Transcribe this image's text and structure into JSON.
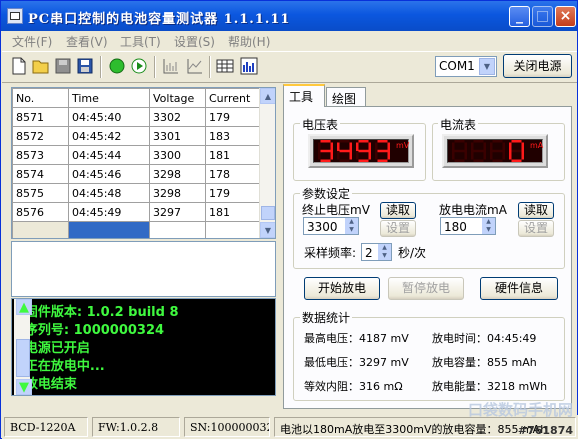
{
  "window": {
    "title": "PC串口控制的电池容量测试器 1.1.1.11"
  },
  "menu": [
    "文件(F)",
    "查看(V)",
    "工具(T)",
    "设置(S)",
    "帮助(H)"
  ],
  "toolbar": {
    "port": "COM1",
    "close_power_label": "关闭电源"
  },
  "table": {
    "columns": [
      "No.",
      "Time",
      "Voltage",
      "Current"
    ],
    "rows": [
      [
        "8571",
        "04:45:40",
        "3302",
        "179"
      ],
      [
        "8572",
        "04:45:42",
        "3301",
        "183"
      ],
      [
        "8573",
        "04:45:44",
        "3300",
        "181"
      ],
      [
        "8574",
        "04:45:46",
        "3298",
        "178"
      ],
      [
        "8575",
        "04:45:48",
        "3298",
        "179"
      ],
      [
        "8576",
        "04:45:49",
        "3297",
        "181"
      ]
    ]
  },
  "log": [
    ">固件版本: 1.0.2 build 8",
    ">序列号: 1000000324",
    ">电源已开启",
    ">正在放电中...",
    ">放电结束"
  ],
  "tabs": [
    "工具",
    "绘图"
  ],
  "meters": {
    "voltage": {
      "label": "电压表",
      "value": "3493",
      "unit": "mV"
    },
    "current": {
      "label": "电流表",
      "value": "0",
      "unit": "mA"
    }
  },
  "params": {
    "title": "参数设定",
    "end_voltage_label": "终止电压mV",
    "end_voltage": "3300",
    "discharge_current_label": "放电电流mA",
    "discharge_current": "180",
    "read_label": "读取",
    "set_label": "设置",
    "sample_label": "采样频率:",
    "sample_value": "2",
    "sample_unit": "秒/次"
  },
  "actions": {
    "start": "开始放电",
    "pause": "暂停放电",
    "hw_info": "硬件信息"
  },
  "stats": {
    "title": "数据统计",
    "max_voltage": "最高电压：4187 mV",
    "min_voltage": "最低电压：3297 mV",
    "resistance": "等效内阻：316 mΩ",
    "time": "放电时间：04:45:49",
    "capacity": "放电容量：855 mAh",
    "energy": "放电能量：3218 mWh"
  },
  "status": {
    "model": "BCD-1220A",
    "fw": "FW:1.0.2.8",
    "sn": "SN:1000000324",
    "message": "电池以180mA放电至3300mV的放电容量：855 mAh"
  },
  "watermark": {
    "text": "口袋数码手机网",
    "id": "#761874"
  },
  "colors": {
    "led_on": "#ff1a1a",
    "led_off": "#3a0000",
    "log_text": "#3ff93f"
  }
}
